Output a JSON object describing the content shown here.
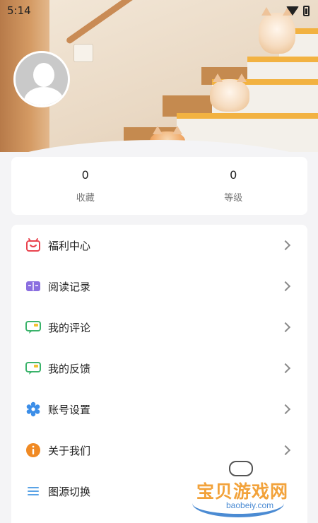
{
  "status_bar": {
    "time": "5:14",
    "icons": [
      "wifi-icon",
      "battery-icon"
    ]
  },
  "profile": {
    "avatar_icon": "default-avatar-icon"
  },
  "stats": [
    {
      "value": "0",
      "label": "收藏"
    },
    {
      "value": "0",
      "label": "等级"
    }
  ],
  "menu": [
    {
      "label": "福利中心",
      "icon": "gift-icon",
      "color": "#e9444f"
    },
    {
      "label": "阅读记录",
      "icon": "book-icon",
      "color": "#8b6fe0"
    },
    {
      "label": "我的评论",
      "icon": "comment-icon",
      "color": "#3bb36b"
    },
    {
      "label": "我的反馈",
      "icon": "feedback-icon",
      "color": "#3bb36b"
    },
    {
      "label": "账号设置",
      "icon": "gear-icon",
      "color": "#3c8ee8"
    },
    {
      "label": "关于我们",
      "icon": "info-icon",
      "color": "#f08a24"
    },
    {
      "label": "图源切换",
      "icon": "list-icon",
      "color": "#5aa3e6"
    }
  ],
  "watermark": {
    "text": "宝贝游戏网",
    "url": "baobeiy.com"
  }
}
